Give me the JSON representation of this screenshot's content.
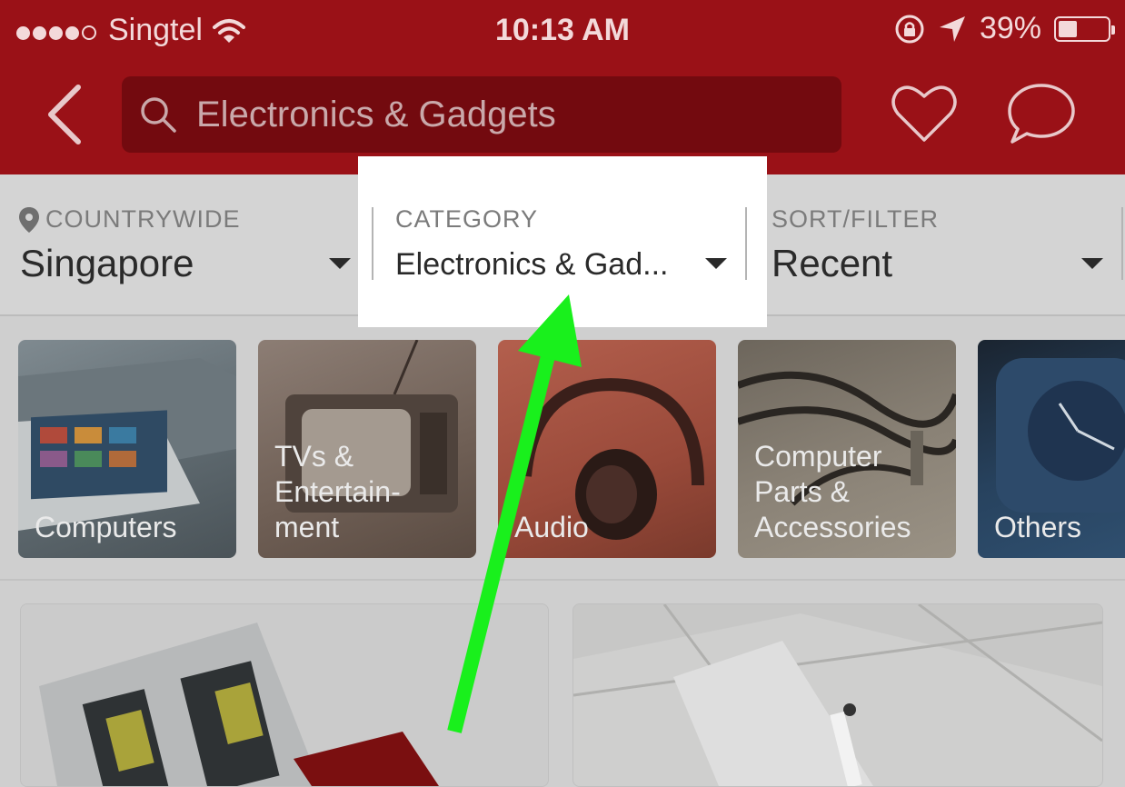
{
  "status_bar": {
    "carrier": "Singtel",
    "time": "10:13 AM",
    "battery": "39%",
    "battery_level": 0.39
  },
  "header": {
    "search_text": "Electronics & Gadgets",
    "background_color": "#9a1117"
  },
  "filters": {
    "location": {
      "label": "COUNTRYWIDE",
      "value": "Singapore"
    },
    "category": {
      "label": "CATEGORY",
      "value": "Electronics & Gad..."
    },
    "sort": {
      "label": "SORT/FILTER",
      "value": "Recent"
    }
  },
  "subcategories": [
    {
      "label": "Computers"
    },
    {
      "label": "TVs &\nEntertain-\nment"
    },
    {
      "label": "Audio"
    },
    {
      "label": "Computer\nParts &\nAccessories"
    },
    {
      "label": "Others"
    }
  ],
  "annotation": {
    "arrow_color": "#19f01c"
  }
}
